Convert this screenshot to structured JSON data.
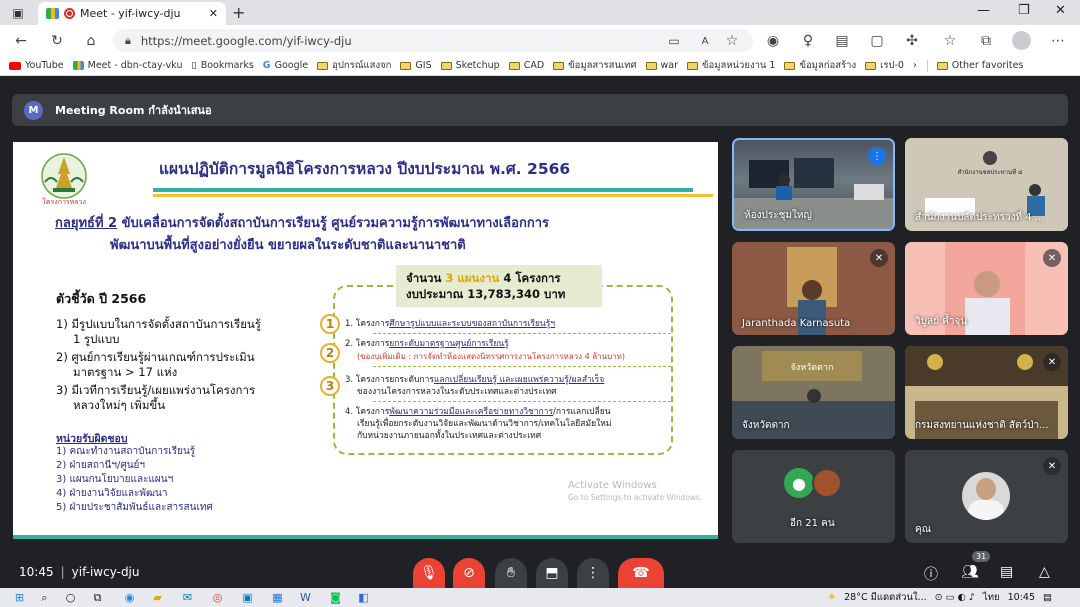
{
  "browser": {
    "tab_title": "Meet - yif-iwcy-dju",
    "url": "https://meet.google.com/yif-iwcy-dju",
    "bookmarks": [
      "YouTube",
      "Meet - dbn-ctay-vku",
      "Bookmarks",
      "Google",
      "อุปกรณ์แสงจก",
      "GIS",
      "Sketchup",
      "CAD",
      "ข้อมูลสารสนเทศ",
      "war",
      "ข้อมูลหน่วยงาน 1",
      "ข้อมูลก่อสร้าง",
      "เรป-0"
    ],
    "other_favorites": "Other favorites"
  },
  "meeting": {
    "room_title": "Meeting Room กำลังนำเสนอ",
    "room_avatar": "M",
    "time": "10:45",
    "code": "yif-iwcy-dju",
    "participant_count": "31"
  },
  "slide": {
    "title": "แผนปฏิบัติการมูลนิธิโครงการหลวง ปีงบประมาณ พ.ศ. 2566",
    "logo_text": "โครงการหลวง",
    "strategy_key": "กลยุทธ์ที่ 2",
    "strategy_line1": " ขับเคลื่อนการจัดตั้งสถาบันการเรียนรู้ ศูนย์รวมความรู้การพัฒนาทางเลือกการ",
    "strategy_line2": "พัฒนาบนพื้นที่สูงอย่างยั่งยืน ขยายผลในระดับชาติและนานาชาติ",
    "indicator_title": "ตัวชี้วัด ปี 2566",
    "indicators": [
      "1) มีรูปแบบในการจัดตั้งสถาบันการเรียนรู้",
      "1 รูปแบบ",
      "2) ศูนย์การเรียนรู้ผ่านเกณฑ์การประเมิน",
      "มาตรฐาน > 17 แห่ง",
      "3) มีเวทีการเรียนรู้/เผยแพร่งานโครงการ",
      "หลวงใหม่ๆ เพิ่มขึ้น"
    ],
    "unit_title": "หน่วยรับผิดชอบ",
    "units": [
      "1) คณะทำงานสถาบันการเรียนรู้",
      "2) ฝ่ายสถานีฯ/ศูนย์ฯ",
      "3) แผนกนโยบายและแผนฯ",
      "4) ฝ่ายงานวิจัยและพัฒนา",
      "5) ฝ่ายประชาสัมพันธ์และสารสนเทศ"
    ],
    "summary_prefix": "จำนวน ",
    "summary_plans": "3 แผนงาน",
    "summary_projects": " 4 โครงการ",
    "summary_budget": "งบประมาณ 13,783,340 บาท",
    "projects": {
      "p1_pre": "1. โครงการ",
      "p1_u": "ศึกษารูปแบบและระบบของสถาบันการเรียนรู้ฯ",
      "p2_pre": "2. โครงการ",
      "p2_u": "ยกระดับมาตรฐานศูนย์การเรียนรู้",
      "p2_note": "(ของบเพิ่มเติม : การจัดทำห้องแสดงนิทรรศการงานโครงการหลวง 4 ล้านบาท)",
      "p3_pre": "3. โครงการยกระดับการ",
      "p3_u": "แลกเปลี่ยนเรียนรู้ และเผยแพร่ความรู้/ผลสำเร็จ",
      "p3_l2": "ของงานโครงการหลวงในระดับประเทศและต่างประเทศ",
      "p4_pre": "4. โครงการ",
      "p4_u": "พัฒนาความร่วมมือและเครือข่ายทางวิชาการ",
      "p4_post": "/การแลกเปลี่ยน",
      "p4_l2": "เรียนรู้เพื่อยกระดับงานวิจัยและพัฒนาด้านวิชาการ/เทคโนโลยีสมัยใหม่",
      "p4_l3": "กับหน่วยงานภายนอกทั้งในประเทศและต่างประเทศ"
    },
    "watermark_l1": "Activate Windows",
    "watermark_l2": "Go to Settings to activate Windows."
  },
  "tiles": [
    {
      "name": "ห้องประชุมใหญ่"
    },
    {
      "name": "สำนักงานปลัดประทรวงที่ 4 ..."
    },
    {
      "name": "Jaranthada Karnasuta"
    },
    {
      "name": "วิบูลย์ ค้ำจุน"
    },
    {
      "name": "จังหวัดตาก"
    },
    {
      "name": "กรมสงทยานแห่งชาติ สัตว์ป่า..."
    },
    {
      "name": "อีก 21 คน"
    },
    {
      "name": "คุณ"
    }
  ],
  "tile_texts": {
    "t2_sign": "สำนักงานชลประทานที่ ๔",
    "t5_sign": "จังหวัดตาก"
  },
  "taskbar": {
    "weather": "28°C มีแดดส่วนใ...",
    "lang": "ไทย",
    "clock": "10:45"
  },
  "colors": {
    "accent": "#1a73e8",
    "end_call": "#ea4335",
    "slide_title": "#2b2f88"
  }
}
